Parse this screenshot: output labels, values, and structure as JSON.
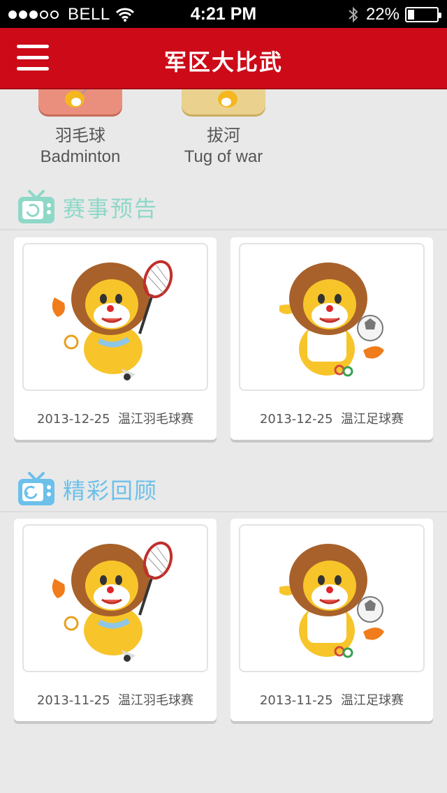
{
  "status_bar": {
    "carrier": "BELL",
    "time": "4:21 PM",
    "battery": "22%",
    "battery_level": 0.22,
    "signal_dots_filled": 3,
    "signal_dots_total": 5
  },
  "nav": {
    "title": "军区大比武",
    "menu_icon": "hamburger-menu-icon"
  },
  "sports": [
    {
      "cn": "羽毛球",
      "en": "Badminton",
      "tile_color": "#ea8e7d"
    },
    {
      "cn": "拔河",
      "en": "Tug of war",
      "tile_color": "#ead28e"
    }
  ],
  "sections": {
    "upcoming": {
      "title": "赛事预告",
      "color": "#8ed8c8",
      "icon": "tv-icon",
      "cards": [
        {
          "date": "2013-12-25",
          "name": "温江羽毛球赛",
          "image": "lion-mascot-badminton"
        },
        {
          "date": "2013-12-25",
          "name": "温江足球赛",
          "image": "lion-mascot-football"
        }
      ]
    },
    "review": {
      "title": "精彩回顾",
      "color": "#6cc0ea",
      "icon": "tv-replay-icon",
      "cards": [
        {
          "date": "2013-11-25",
          "name": "温江羽毛球赛",
          "image": "lion-mascot-badminton"
        },
        {
          "date": "2013-11-25",
          "name": "温江足球赛",
          "image": "lion-mascot-football"
        }
      ]
    }
  },
  "colors": {
    "nav_red": "#cc0a18",
    "background": "#e9e9e9"
  }
}
